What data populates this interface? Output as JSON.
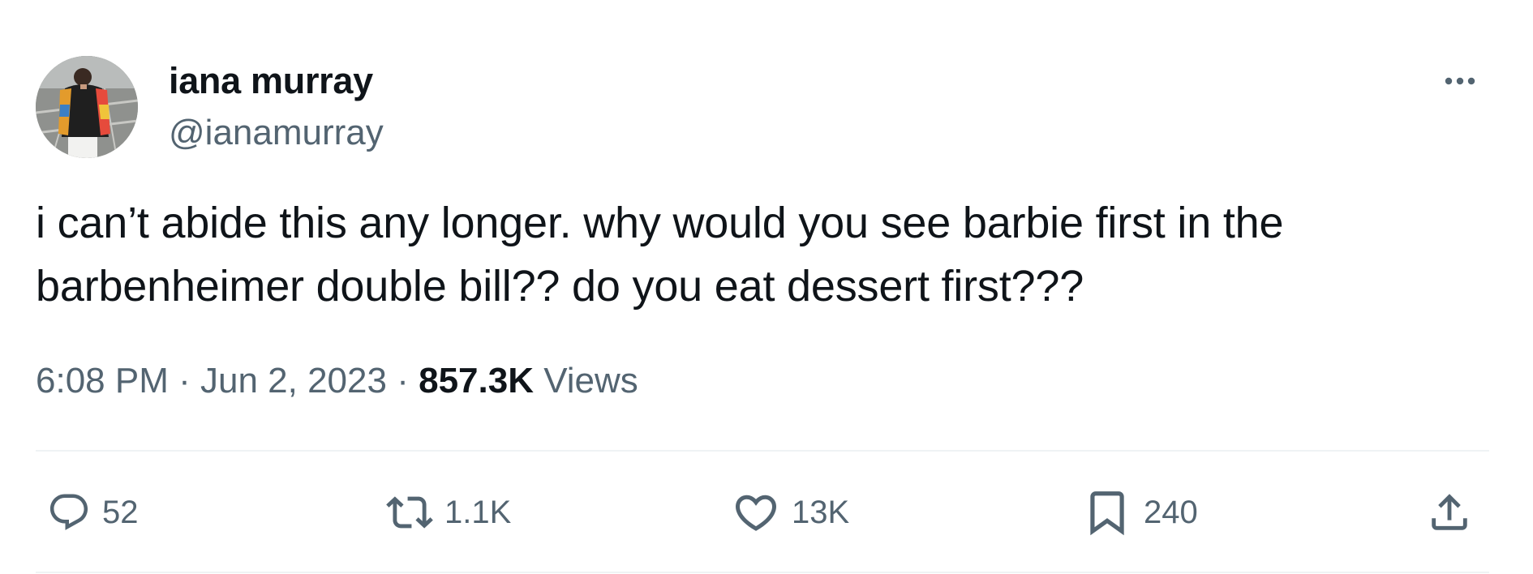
{
  "author": {
    "display_name": "iana murray",
    "handle": "@ianamurray",
    "avatar": "avatar-photo"
  },
  "tweet": {
    "text_lines": [
      "i can’t abide this any longer. why would you see barbie first in the",
      "barbenheimer double bill?? do you eat dessert first???"
    ]
  },
  "meta": {
    "time": "6:08 PM",
    "separator": "·",
    "date": "Jun 2, 2023",
    "views_count": "857.3K",
    "views_label": "Views"
  },
  "actions": {
    "replies": {
      "icon": "reply-icon",
      "count": "52"
    },
    "retweets": {
      "icon": "retweet-icon",
      "count": "1.1K"
    },
    "likes": {
      "icon": "heart-icon",
      "count": "13K"
    },
    "bookmarks": {
      "icon": "bookmark-icon",
      "count": "240"
    },
    "share": {
      "icon": "share-icon"
    }
  },
  "colors": {
    "text_primary": "#0f1419",
    "text_secondary": "#536471",
    "divider": "#eff3f4"
  }
}
